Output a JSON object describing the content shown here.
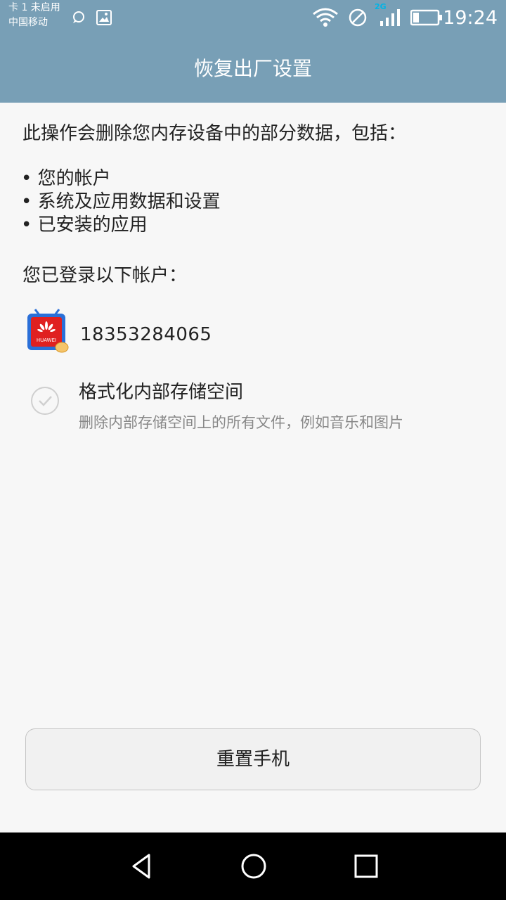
{
  "status_bar": {
    "carrier_line1": "卡 1 未启用",
    "carrier_line2": "中国移动",
    "network_badge": "2G",
    "time": "19:24",
    "icons": [
      "message-icon",
      "image-icon",
      "wifi-icon",
      "no-sim-icon",
      "signal-icon",
      "battery-icon"
    ]
  },
  "header": {
    "title": "恢复出厂设置"
  },
  "main": {
    "intro": "此操作会删除您内存设备中的部分数据，包括：",
    "bullets": [
      "您的帐户",
      "系统及应用数据和设置",
      "已安装的应用"
    ],
    "accounts_label": "您已登录以下帐户：",
    "account": {
      "number": "18353284065",
      "icon_text": "HUAWEI",
      "icon": "huawei-account-icon"
    },
    "format_option": {
      "title": "格式化内部存储空间",
      "subtitle": "删除内部存储空间上的所有文件，例如音乐和图片",
      "checked": false
    },
    "reset_button": "重置手机"
  },
  "nav_bar": {
    "icons": [
      "back-icon",
      "home-icon",
      "recents-icon"
    ]
  },
  "colors": {
    "header": "#789fb6",
    "background": "#f7f7f7",
    "navbar": "#000000",
    "badge": "#00b4e6"
  }
}
